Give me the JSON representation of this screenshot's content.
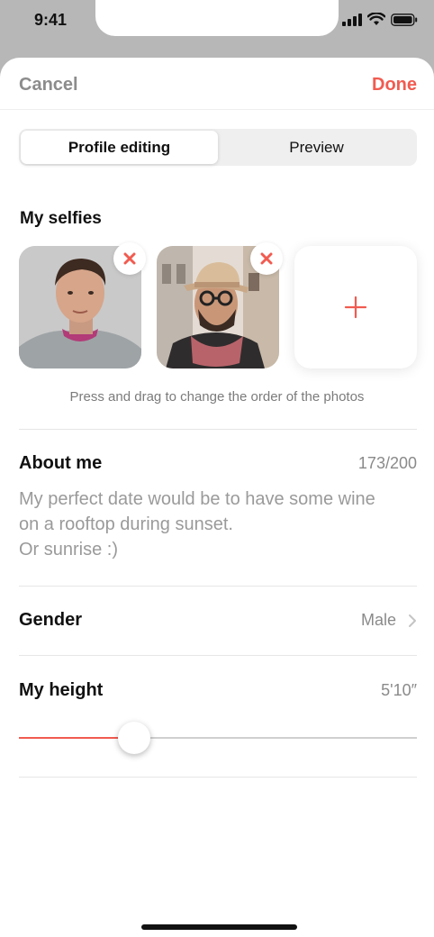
{
  "status_bar": {
    "time": "9:41",
    "icons": [
      "signal-icon",
      "wifi-icon",
      "battery-icon"
    ]
  },
  "nav": {
    "cancel_label": "Cancel",
    "done_label": "Done"
  },
  "tabs": [
    {
      "label": "Profile editing",
      "active": true
    },
    {
      "label": "Preview",
      "active": false
    }
  ],
  "selfies": {
    "title": "My selfies",
    "photos": [
      {
        "alt": "selfie-photo-1"
      },
      {
        "alt": "selfie-photo-2"
      }
    ],
    "hint": "Press and drag to change the order of the photos"
  },
  "about": {
    "label": "About me",
    "counter": "173/200",
    "text": "My perfect date would be to have some wine\non a rooftop during sunset.\nOr sunrise :)"
  },
  "gender": {
    "label": "Gender",
    "value": "Male"
  },
  "height": {
    "label": "My height",
    "value": "5'10″",
    "slider_fraction": 0.29
  },
  "colors": {
    "accent": "#f15b50",
    "muted": "#8c8c8c"
  }
}
